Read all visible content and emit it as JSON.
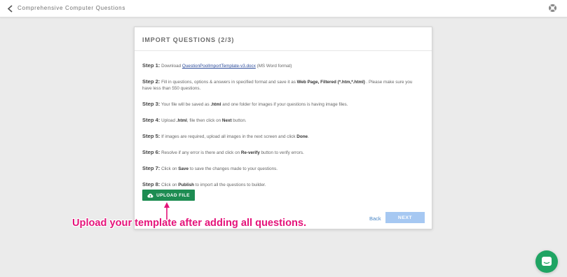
{
  "header": {
    "title": "Comprehensive Computer Questions",
    "back_icon": "chevron-left-icon",
    "help_icon": "lifebuoy-icon"
  },
  "modal": {
    "title": "IMPORT QUESTIONS (2/3)",
    "steps": [
      {
        "label": "Step 1:",
        "pre": "Download ",
        "link": "QuestionPoolImportTemplate-v3.docx",
        "post": " (MS Word format)"
      },
      {
        "label": "Step 2:",
        "pre": "Fill in questions, options & answers in specified format and save it as ",
        "bold": "Web Page, Filtered (*.htm,*.html)",
        "post": " . Please make sure you have less than 550 questions."
      },
      {
        "label": "Step 3:",
        "pre": "Your file will be saved as ",
        "bold": ".html",
        "post": " and one folder for images if your questions is having image files."
      },
      {
        "label": "Step 4:",
        "pre": "Upload ",
        "bold": ".html",
        "mid": ", file then click on ",
        "bold2": "Next",
        "post": " button."
      },
      {
        "label": "Step 5:",
        "pre": "If images are required, upload all images in the next screen and click ",
        "bold": "Done",
        "post": "."
      },
      {
        "label": "Step 6:",
        "pre": "Resolve if any error is there and click on ",
        "bold": "Re-verify",
        "post": " button to verify errors."
      },
      {
        "label": "Step 7:",
        "pre": "Click on ",
        "bold": "Save",
        "post": " to save the changes made to your questions."
      },
      {
        "label": "Step 8:",
        "pre": "Click on ",
        "bold": "Publish",
        "post": " to import all the questions to builder."
      }
    ],
    "upload_label": "UPLOAD FILE",
    "upload_icon": "cloud-upload-icon",
    "back_label": "Back",
    "next_label": "NEXT"
  },
  "annotation": {
    "text": "Upload your template after adding all questions.",
    "color": "#e5137a"
  },
  "chat": {
    "icon": "chat-icon",
    "color": "#1fa463"
  }
}
